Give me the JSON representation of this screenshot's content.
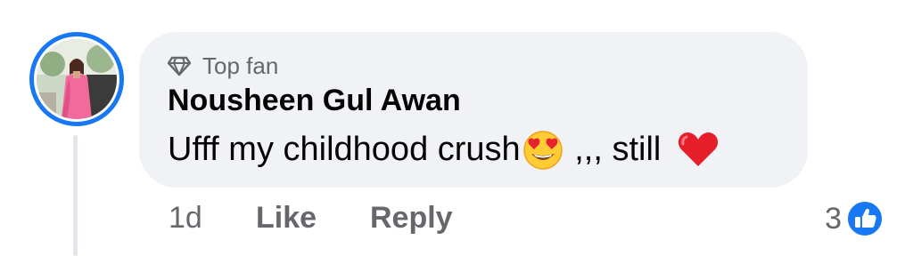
{
  "comment": {
    "badge": {
      "icon": "diamond-icon",
      "label": "Top fan"
    },
    "author": "Nousheen Gul Awan",
    "text_before_emoji": "Ufff my childhood crush",
    "emoji_1": "heart-eyes-emoji",
    "text_middle": " ,,, still ",
    "emoji_2": "red-heart-emoji",
    "timestamp": "1d",
    "like_label": "Like",
    "reply_label": "Reply",
    "reaction_count": "3",
    "reaction_icon": "like-reaction-icon"
  },
  "colors": {
    "accent": "#1877f2",
    "bubble": "#f0f2f5",
    "text_primary": "#050505",
    "text_secondary": "#65676b",
    "thread_line": "#e4e6eb"
  }
}
